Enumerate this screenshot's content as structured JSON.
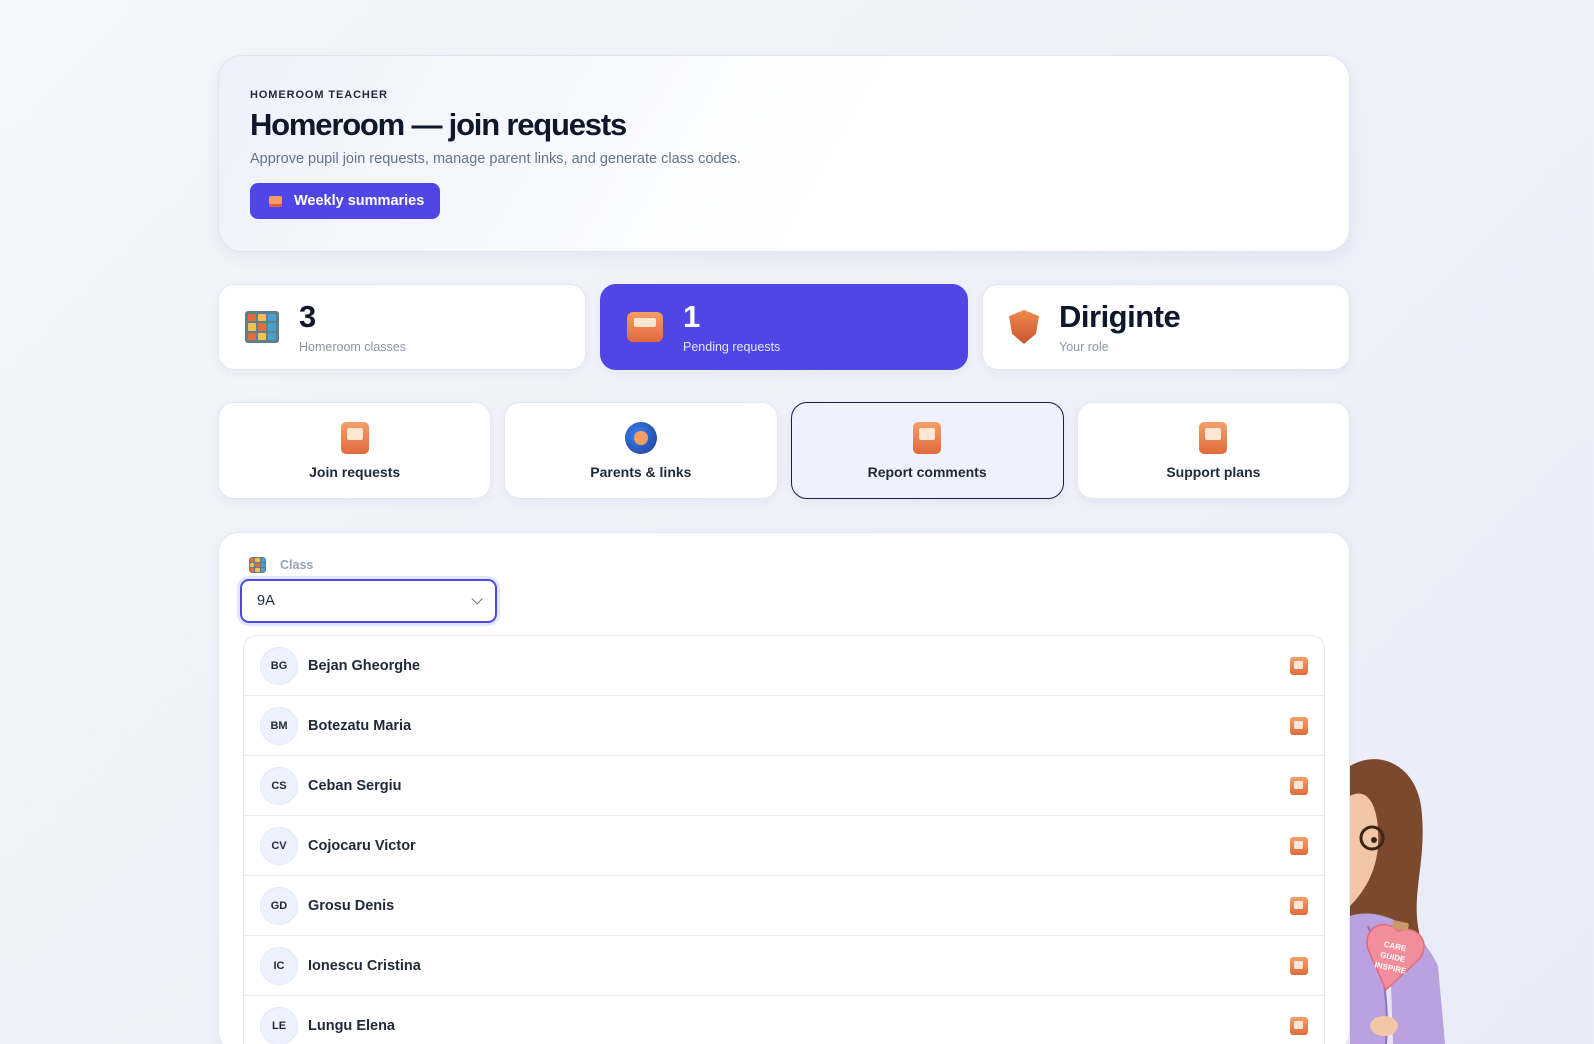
{
  "hero": {
    "eyebrow": "HOMEROOM TEACHER",
    "title": "Homeroom — join requests",
    "subtitle": "Approve pupil join requests, manage parent links, and generate class codes.",
    "button_label": "Weekly summaries",
    "button_icon": "calendar-icon"
  },
  "stats": [
    {
      "value": "3",
      "label": "Homeroom classes",
      "icon": "classroom-shelf-icon"
    },
    {
      "value": "1",
      "label": "Pending requests",
      "icon": "inbox-box-icon"
    },
    {
      "value": "Diriginte",
      "label": "Your role",
      "icon": "shield-badge-icon"
    }
  ],
  "tabs": [
    {
      "label": "Join requests",
      "icon": "door-icon"
    },
    {
      "label": "Parents & links",
      "icon": "family-globe-icon"
    },
    {
      "label": "Report comments",
      "icon": "report-note-icon",
      "selected": true
    },
    {
      "label": "Support plans",
      "icon": "support-plan-icon"
    }
  ],
  "class_select": {
    "label": "Class",
    "value": "9A"
  },
  "pupils": [
    {
      "initials": "BG",
      "name": "Bejan Gheorghe"
    },
    {
      "initials": "BM",
      "name": "Botezatu Maria"
    },
    {
      "initials": "CS",
      "name": "Ceban Sergiu"
    },
    {
      "initials": "CV",
      "name": "Cojocaru Victor"
    },
    {
      "initials": "GD",
      "name": "Grosu Denis"
    },
    {
      "initials": "IC",
      "name": "Ionescu Cristina"
    },
    {
      "initials": "LE",
      "name": "Lungu Elena"
    }
  ],
  "mascot": {
    "clipboard_text": "CARE GUIDE INSPIRE"
  },
  "colors": {
    "accent": "#4f46e5",
    "icon_orange": "#e06a3c"
  }
}
